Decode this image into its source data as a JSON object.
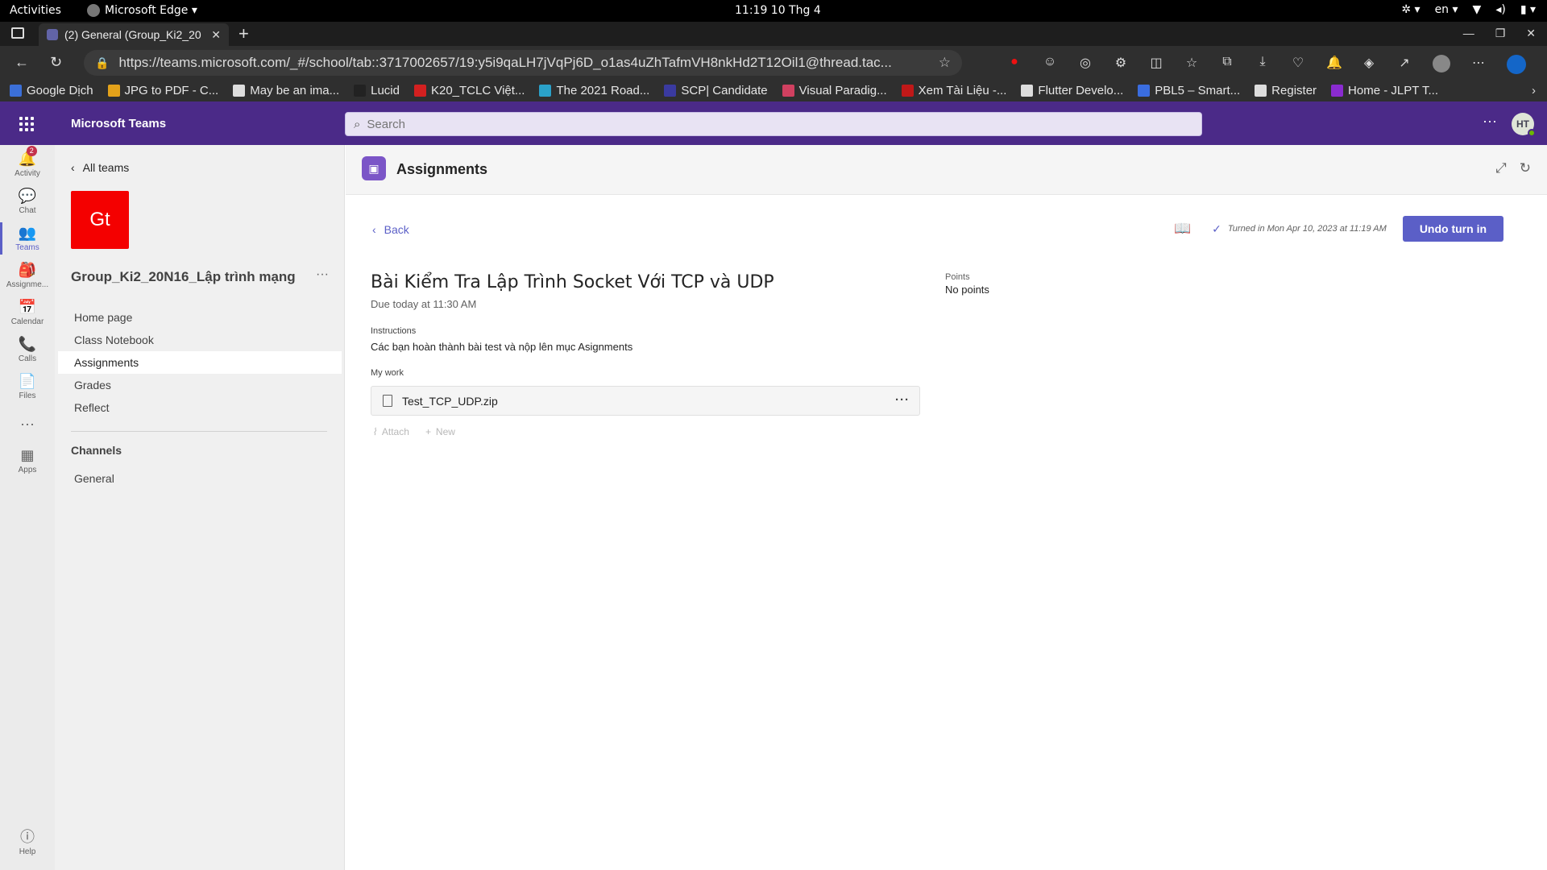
{
  "os": {
    "activities": "Activities",
    "app_name": "Microsoft Edge ▾",
    "clock": "11:19  10 Thg 4",
    "lang": "en ▾"
  },
  "browser": {
    "tab_title": "(2) General (Group_Ki2_20",
    "url": "https://teams.microsoft.com/_#/school/tab::3717002657/19:y5i9qaLH7jVqPj6D_o1as4uZhTafmVH8nkHd2T12Oil1@thread.tac...",
    "bookmarks": [
      {
        "label": "Google Dịch",
        "color": "#3b6fd8"
      },
      {
        "label": "JPG to PDF - C...",
        "color": "#e3a21a"
      },
      {
        "label": "May be an ima...",
        "color": "#dddddd"
      },
      {
        "label": "Lucid",
        "color": "#222222"
      },
      {
        "label": "K20_TCLC Việt...",
        "color": "#d32020"
      },
      {
        "label": "The 2021 Road...",
        "color": "#2aa1c9"
      },
      {
        "label": "SCP| Candidate",
        "color": "#3a3aa0"
      },
      {
        "label": "Visual Paradig...",
        "color": "#d04060"
      },
      {
        "label": "Xem Tài Liệu -...",
        "color": "#c01818"
      },
      {
        "label": "Flutter Develo...",
        "color": "#dddddd"
      },
      {
        "label": "PBL5 – Smart...",
        "color": "#3a6de0"
      },
      {
        "label": "Register",
        "color": "#dddddd"
      },
      {
        "label": "Home - JLPT T...",
        "color": "#8a2bd0"
      }
    ]
  },
  "teams": {
    "app_title": "Microsoft Teams",
    "search_placeholder": "Search",
    "user_initials": "HT"
  },
  "rail": [
    {
      "label": "Activity",
      "icon": "bell-icon",
      "badge": "2"
    },
    {
      "label": "Chat",
      "icon": "chat-icon"
    },
    {
      "label": "Teams",
      "icon": "teams-icon"
    },
    {
      "label": "Assignme...",
      "icon": "backpack-icon"
    },
    {
      "label": "Calendar",
      "icon": "calendar-icon"
    },
    {
      "label": "Calls",
      "icon": "phone-icon"
    },
    {
      "label": "Files",
      "icon": "file-icon"
    },
    {
      "label": "Apps",
      "icon": "apps-icon"
    },
    {
      "label": "Help",
      "icon": "help-icon"
    }
  ],
  "left": {
    "all_teams": "All teams",
    "team_initials": "Gt",
    "team_name": "Group_Ki2_20N16_Lập trình mạng",
    "nav": [
      "Home page",
      "Class Notebook",
      "Assignments",
      "Grades",
      "Reflect"
    ],
    "channels_heading": "Channels",
    "channels": [
      "General"
    ]
  },
  "main": {
    "app_title": "Assignments",
    "back": "Back",
    "turned_in": "Turned in Mon Apr 10, 2023 at 11:19 AM",
    "undo_button": "Undo turn in",
    "assignment_title": "Bài Kiểm Tra Lập Trình Socket Với TCP và UDP",
    "due": "Due today at 11:30 AM",
    "points_label": "Points",
    "points_value": "No points",
    "instructions_label": "Instructions",
    "instructions_text": "Các bạn hoàn thành bài test và nộp lên mục Asignments",
    "mywork_label": "My work",
    "file_name": "Test_TCP_UDP.zip",
    "attach": "Attach",
    "new": "New"
  }
}
